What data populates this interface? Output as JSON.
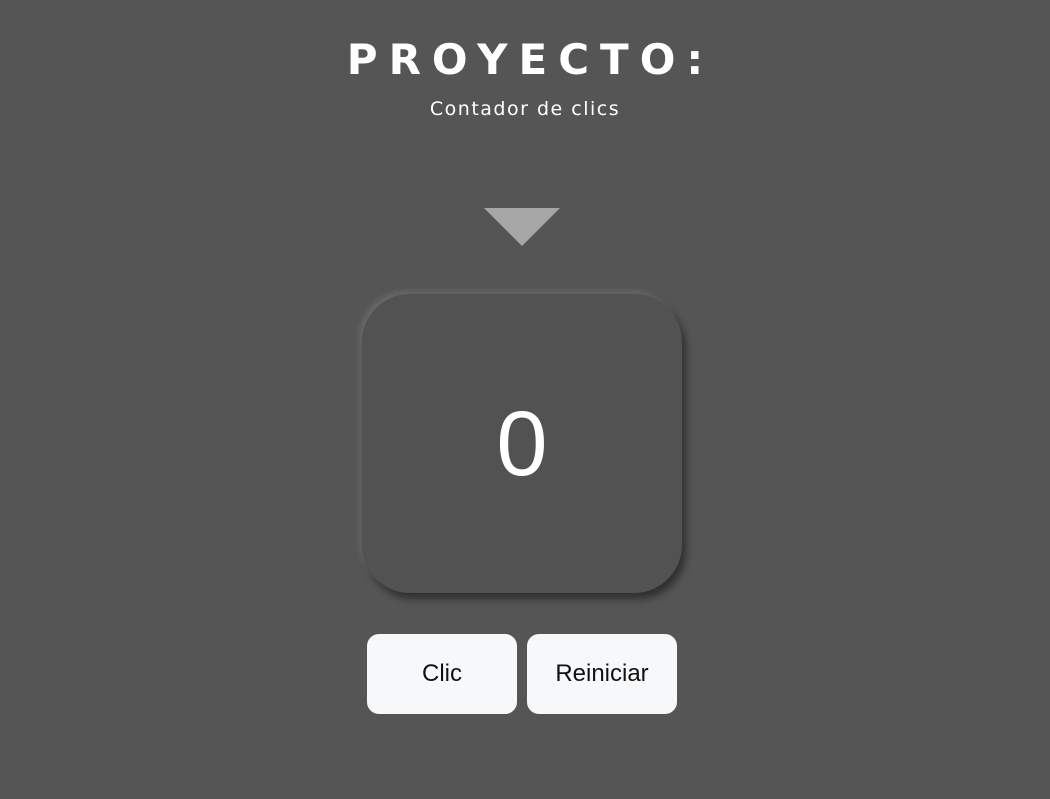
{
  "header": {
    "title": "PROYECTO:",
    "subtitle": "Contador de clics"
  },
  "indicator": {
    "icon": "triangle-down-icon",
    "color": "#a6a6a6"
  },
  "counter": {
    "value": "0"
  },
  "buttons": {
    "click_label": "Clic",
    "reset_label": "Reiniciar"
  },
  "colors": {
    "background": "#555555",
    "counter_box": "#525252",
    "button_bg": "#f7f8fa",
    "text": "#ffffff"
  }
}
